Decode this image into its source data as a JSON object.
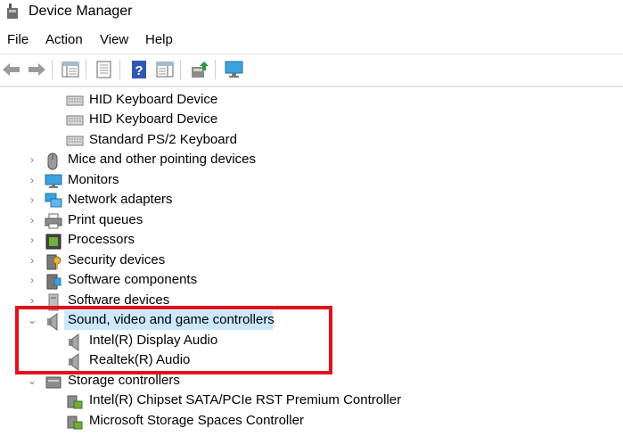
{
  "window": {
    "title": "Device Manager"
  },
  "menu": [
    "File",
    "Action",
    "View",
    "Help"
  ],
  "toolbar": {
    "buttons": [
      "back-icon",
      "forward-icon",
      "properties-pane-icon",
      "details-icon",
      "help-icon",
      "view-icon",
      "update-driver-icon",
      "monitor-scan-icon"
    ]
  },
  "tree": [
    {
      "label": "HID Keyboard Device",
      "icon": "keyboard-icon",
      "level": 2
    },
    {
      "label": "HID Keyboard Device",
      "icon": "keyboard-icon",
      "level": 2
    },
    {
      "label": "Standard PS/2 Keyboard",
      "icon": "keyboard-icon",
      "level": 2
    },
    {
      "label": "Mice and other pointing devices",
      "icon": "mouse-icon",
      "level": 1,
      "expander": "›"
    },
    {
      "label": "Monitors",
      "icon": "monitor-icon",
      "level": 1,
      "expander": "›"
    },
    {
      "label": "Network adapters",
      "icon": "network-icon",
      "level": 1,
      "expander": "›"
    },
    {
      "label": "Print queues",
      "icon": "printer-icon",
      "level": 1,
      "expander": "›"
    },
    {
      "label": "Processors",
      "icon": "processor-icon",
      "level": 1,
      "expander": "›"
    },
    {
      "label": "Security devices",
      "icon": "security-icon",
      "level": 1,
      "expander": "›"
    },
    {
      "label": "Software components",
      "icon": "component-icon",
      "level": 1,
      "expander": "›"
    },
    {
      "label": "Software devices",
      "icon": "software-device-icon",
      "level": 1,
      "expander": "›"
    },
    {
      "label": "Sound, video and game controllers",
      "icon": "speaker-icon",
      "level": 1,
      "expander": "⌄",
      "selected": true
    },
    {
      "label": "Intel(R) Display Audio",
      "icon": "speaker-icon",
      "level": 2
    },
    {
      "label": "Realtek(R) Audio",
      "icon": "speaker-icon",
      "level": 2
    },
    {
      "label": "Storage controllers",
      "icon": "storage-icon",
      "level": 1,
      "expander": "⌄"
    },
    {
      "label": "Intel(R) Chipset SATA/PCIe RST Premium Controller",
      "icon": "storage-controller-icon",
      "level": 2
    },
    {
      "label": "Microsoft Storage Spaces Controller",
      "icon": "storage-controller-icon",
      "level": 2
    }
  ],
  "highlight": {
    "color": "#e2111c"
  },
  "selection_color": "#cce8ff"
}
